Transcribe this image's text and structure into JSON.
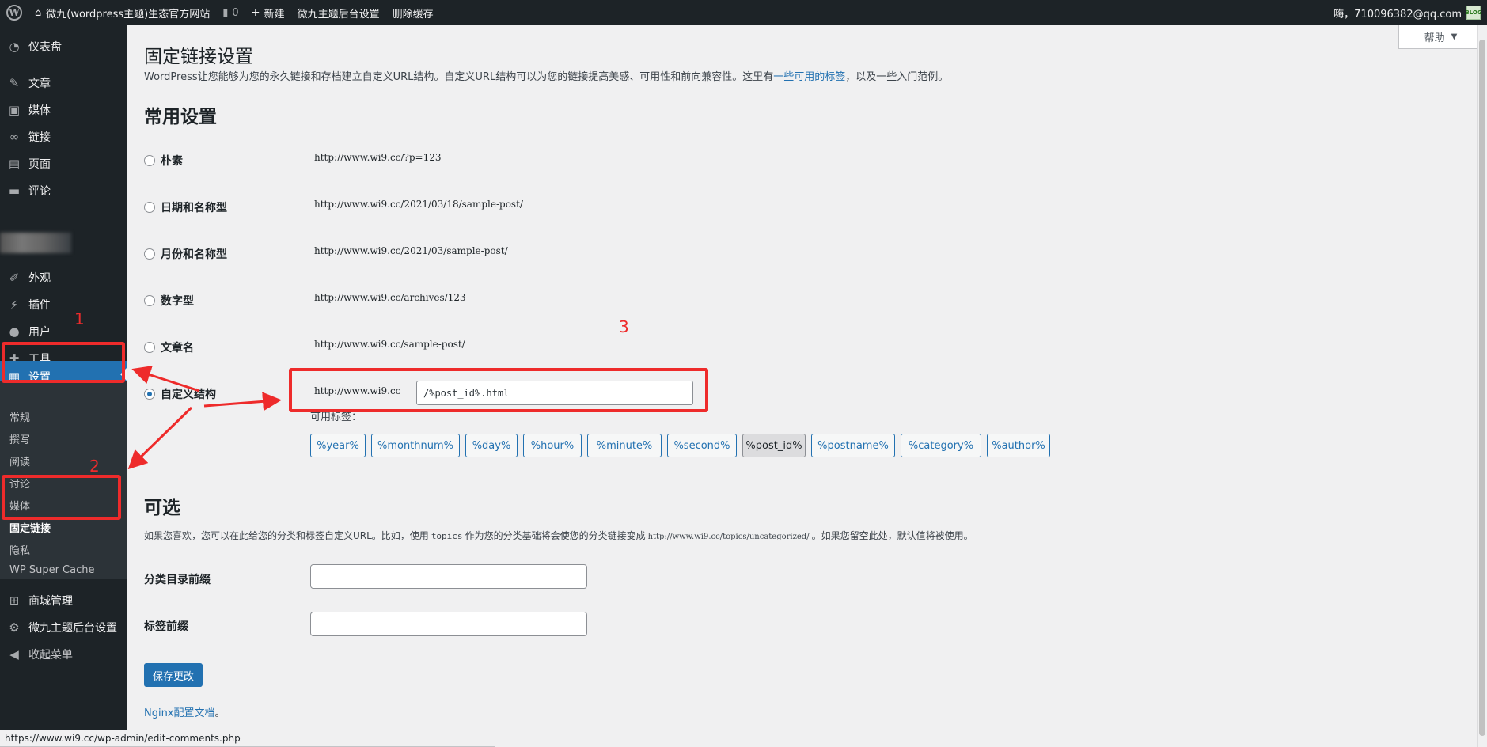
{
  "adminbar": {
    "site_name": "微九(wordpress主题)生态官方网站",
    "comments_count": "0",
    "new_label": "新建",
    "theme_settings": "微九主题后台设置",
    "clear_cache": "删除缓存",
    "greeting": "嗨，710096382@qq.com",
    "avatar_text": "BLOG"
  },
  "sidebar": {
    "dashboard": "仪表盘",
    "posts": "文章",
    "media": "媒体",
    "links": "链接",
    "pages": "页面",
    "comments": "评论",
    "appearance": "外观",
    "plugins": "插件",
    "users": "用户",
    "tools": "工具",
    "settings": "设置",
    "submenu": [
      "常规",
      "撰写",
      "阅读",
      "讨论",
      "媒体",
      "固定链接",
      "隐私",
      "WP Super Cache"
    ],
    "shop": "商城管理",
    "theme_admin": "微九主题后台设置",
    "collapse": "收起菜单"
  },
  "page": {
    "help": "帮助",
    "title": "固定链接设置",
    "intro_before": "WordPress让您能够为您的永久链接和存档建立自定义URL结构。自定义URL结构可以为您的链接提高美感、可用性和前向兼容性。这里有",
    "intro_link": "一些可用的标签",
    "intro_after": "，以及一些入门范例。",
    "common_heading": "常用设置",
    "options": [
      {
        "label": "朴素",
        "url": "http://www.wi9.cc/?p=123"
      },
      {
        "label": "日期和名称型",
        "url": "http://www.wi9.cc/2021/03/18/sample-post/"
      },
      {
        "label": "月份和名称型",
        "url": "http://www.wi9.cc/2021/03/sample-post/"
      },
      {
        "label": "数字型",
        "url": "http://www.wi9.cc/archives/123"
      },
      {
        "label": "文章名",
        "url": "http://www.wi9.cc/sample-post/"
      },
      {
        "label": "自定义结构",
        "url": "http://www.wi9.cc"
      }
    ],
    "custom_value": "/%post_id%.html",
    "tags_label": "可用标签：",
    "tags": [
      "%year%",
      "%monthnum%",
      "%day%",
      "%hour%",
      "%minute%",
      "%second%",
      "%post_id%",
      "%postname%",
      "%category%",
      "%author%"
    ],
    "optional_heading": "可选",
    "optional_before": "如果您喜欢，您可以在此给您的分类和标签自定义URL。比如，使用",
    "optional_code1": "topics",
    "optional_middle": "作为您的分类基础将会使您的分类链接变成",
    "optional_code2": "http://www.wi9.cc/topics/uncategorized/",
    "optional_after": "。如果您留空此处，默认值将被使用。",
    "category_base_label": "分类目录前缀",
    "tag_base_label": "标签前缀",
    "save_button": "保存更改",
    "nginx_link": "Nginx配置文档",
    "nginx_after": "。"
  },
  "annotations": {
    "n1": "1",
    "n2": "2",
    "n3": "3",
    "color": "#ee2b2b"
  },
  "status_url": "https://www.wi9.cc/wp-admin/edit-comments.php"
}
